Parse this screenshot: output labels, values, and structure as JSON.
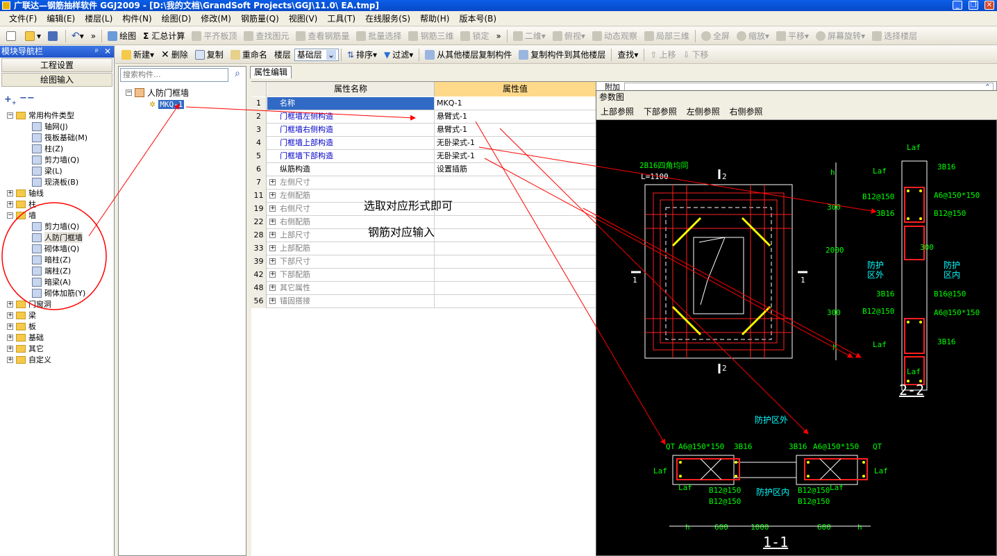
{
  "window": {
    "title": "广联达—钢筋抽样软件 GGJ2009 - [D:\\我的文档\\GrandSoft Projects\\GGJ\\11.0\\ EA.tmp]",
    "minimize": "_",
    "restore": "❐",
    "close": "✕"
  },
  "menu": [
    "文件(F)",
    "编辑(E)",
    "楼层(L)",
    "构件(N)",
    "绘图(D)",
    "修改(M)",
    "钢筋量(Q)",
    "视图(V)",
    "工具(T)",
    "在线服务(S)",
    "帮助(H)",
    "版本号(B)"
  ],
  "toolbar": {
    "draw": "绘图",
    "sum": "汇总计算",
    "align_slab": "平齐板顶",
    "find_elem": "查找图元",
    "view_rebar": "查看钢筋量",
    "batch_select": "批量选择",
    "rebar_3d": "钢筋三维",
    "lock": "锁定",
    "view_2d": "二维",
    "top_view": "俯视",
    "dyn_view": "动态观察",
    "local_3d": "局部三维",
    "fullscreen": "全屏",
    "zoom": "缩放",
    "pan": "平移",
    "rotate": "屏幕旋转",
    "select_floor": "选择楼层"
  },
  "nav": {
    "title": "模块导航栏",
    "pin": "ᵖ",
    "close": "✕",
    "btn_project": "工程设置",
    "btn_draw": "绘图输入",
    "tree": [
      {
        "label": "常用构件类型",
        "exp": "−"
      },
      {
        "label": "轴网(J)"
      },
      {
        "label": "筏板基础(M)"
      },
      {
        "label": "柱(Z)"
      },
      {
        "label": "剪力墙(Q)"
      },
      {
        "label": "梁(L)"
      },
      {
        "label": "现浇板(B)"
      },
      {
        "label": "轴线",
        "exp": "+"
      },
      {
        "label": "柱",
        "exp": "+"
      },
      {
        "label": "墙",
        "exp": "−"
      },
      {
        "label": "剪力墙(Q)"
      },
      {
        "label": "人防门框墙"
      },
      {
        "label": "砌体墙(Q)"
      },
      {
        "label": "暗柱(Z)"
      },
      {
        "label": "端柱(Z)"
      },
      {
        "label": "暗梁(A)"
      },
      {
        "label": "砌体加筋(Y)"
      },
      {
        "label": "门窗洞",
        "exp": "+"
      },
      {
        "label": "梁",
        "exp": "+"
      },
      {
        "label": "板",
        "exp": "+"
      },
      {
        "label": "基础",
        "exp": "+"
      },
      {
        "label": "其它",
        "exp": "+"
      },
      {
        "label": "自定义",
        "exp": "+"
      }
    ]
  },
  "comp_toolbar": {
    "new": "新建",
    "delete": "删除",
    "copy": "复制",
    "rename": "重命名",
    "floor_label": "楼层",
    "floor_value": "基础层",
    "sort": "排序",
    "filter": "过滤",
    "copy_from": "从其他楼层复制构件",
    "copy_to": "复制构件到其他楼层",
    "find": "查找",
    "up": "上移",
    "down": "下移"
  },
  "search": {
    "placeholder": "搜索构件..."
  },
  "comp_tree": {
    "root": "人防门框墙",
    "child": "MKQ-1"
  },
  "property": {
    "tab": "属性编辑",
    "head_name": "属性名称",
    "head_value": "属性值",
    "extra": "附加",
    "rows": [
      {
        "num": "1",
        "name": "名称",
        "value": "MKQ-1"
      },
      {
        "num": "2",
        "name": "门框墙左侧构造",
        "value": "悬臂式-1"
      },
      {
        "num": "3",
        "name": "门框墙右侧构造",
        "value": "悬臂式-1"
      },
      {
        "num": "4",
        "name": "门框墙上部构造",
        "value": "无卧梁式-1"
      },
      {
        "num": "5",
        "name": "门框墙下部构造",
        "value": "无卧梁式-1"
      },
      {
        "num": "6",
        "name": "纵筋构造",
        "value": "设置插筋"
      },
      {
        "num": "7",
        "name": "左侧尺寸",
        "value": ""
      },
      {
        "num": "11",
        "name": "左侧配筋",
        "value": ""
      },
      {
        "num": "19",
        "name": "右侧尺寸",
        "value": ""
      },
      {
        "num": "22",
        "name": "右侧配筋",
        "value": ""
      },
      {
        "num": "28",
        "name": "上部尺寸",
        "value": ""
      },
      {
        "num": "33",
        "name": "上部配筋",
        "value": ""
      },
      {
        "num": "39",
        "name": "下部尺寸",
        "value": ""
      },
      {
        "num": "42",
        "name": "下部配筋",
        "value": ""
      },
      {
        "num": "48",
        "name": "其它属性",
        "value": ""
      },
      {
        "num": "56",
        "name": "锚固搭接",
        "value": ""
      }
    ]
  },
  "annotation": {
    "line1": "选取对应形式即可",
    "line2": "钢筋对应输入"
  },
  "cad": {
    "title": "参数图",
    "tabs": [
      "上部参照",
      "下部参照",
      "左侧参照",
      "右侧参照"
    ],
    "labels": {
      "top_rebar": "2B16四角均同",
      "length": "L=1100",
      "sec_2": "2",
      "sec_1": "1",
      "h": "h",
      "d300a": "300",
      "d2000": "2000",
      "d300b": "300",
      "d300c": "300",
      "laf": "Laf",
      "b3b16": "3B16",
      "b12": "B12@150",
      "a6": "A6@150*150",
      "outside": "防护\n区外",
      "inside": "防护\n区内",
      "b16_150": "B16@150",
      "title_22": "2-2",
      "outside2": "防护区外",
      "inside2": "防护区内",
      "qt": "QT",
      "d600": "600",
      "d1000": "1000",
      "title_11": "1-1"
    }
  },
  "colors": {
    "arrow": "#ff0000",
    "cad_green": "#00ff00",
    "cad_cyan": "#00ffff",
    "cad_yellow": "#ffff00",
    "cad_red": "#ff2020"
  }
}
